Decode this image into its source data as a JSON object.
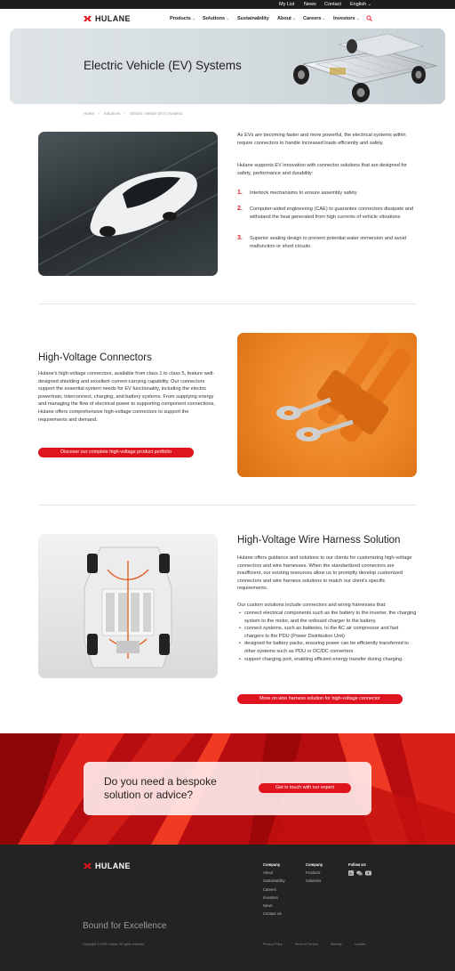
{
  "utility_nav": {
    "my_list": "My List",
    "news": "News",
    "contact": "Contact",
    "language": "English"
  },
  "brand": {
    "name": "HULANE",
    "accent": "#e0141e"
  },
  "main_nav": [
    {
      "label": "Products",
      "dropdown": true
    },
    {
      "label": "Solutions",
      "dropdown": true
    },
    {
      "label": "Sustainability",
      "dropdown": false
    },
    {
      "label": "About",
      "dropdown": true
    },
    {
      "label": "Careers",
      "dropdown": true
    },
    {
      "label": "Investors",
      "dropdown": true
    }
  ],
  "hero": {
    "title": "Electric Vehicle (EV) Systems"
  },
  "breadcrumb": [
    "Home",
    "Solutions",
    "Electric Vehicle (EV) Systems"
  ],
  "intro": {
    "p1": "As EVs are becoming faster and more powerful, the electrical systems within require connectors to handle increased loads efficiently and safely.",
    "p2": "Hulane supports EV innovation with connector solutions that are designed for safety, performance and durability:",
    "items": [
      {
        "num": "1.",
        "text": "Interlock mechanisms to ensure assembly safety"
      },
      {
        "num": "2.",
        "text": "Computer-aided engineering (CAE) to guarantee connectors dissipate and withstand the heat generated from high currents of vehicle vibrations"
      },
      {
        "num": "3.",
        "text": "Superior sealing design to prevent potential water immersion and avoid malfunction or short circuits"
      }
    ]
  },
  "hv_connectors": {
    "title": "High-Voltage Connectors",
    "body": "Hulane's high-voltage connectors, available from class 1 to class 5, feature well-designed shielding and excellent current-carrying capability. Our connectors support the essential system needs for EV functionality, including the electric powertrain, interconnect, charging, and battery systems. From supplying energy and managing the flow of electrical power to supporting component connections, Hulane offers comprehensive high-voltage connectors to support the requirements and demand.",
    "button": "Discover our complete high-voltage product portfolio"
  },
  "wire_harness": {
    "title": "High-Voltage Wire Harness Solution",
    "body": "Hulane offers guidance and solutions to our clients for customizing high-voltage connectors and wire harnesses. When the standardized connectors are insufficient, our existing resources allow us to promptly develop customized connectors and wire harness solutions to match our client's specific requirements.",
    "list_intro": "Our custom solutions include connectors and wiring harnesses that:",
    "bullets": [
      "connect electrical components such as the battery to the inverter, the charging system to the motor, and the onboard charger to the battery.",
      "connect systems, such as batteries, to the AC air compressor and fast chargers to the PDU (Power Distribution Unit)",
      "designed for battery packs, ensuring power can be efficiently transferred to other systems such as PDU or DC/DC converters",
      "support charging port, enabling efficient energy transfer during charging."
    ],
    "button": "More on wire harness solution for high-voltage connector"
  },
  "cta": {
    "title": "Do you need a bespoke solution or advice?",
    "button": "Get in touch with our expert"
  },
  "footer": {
    "tagline": "Bound for Excellence",
    "company_col": {
      "title": "Company",
      "links": [
        "About",
        "Sustainability",
        "Careers",
        "Investors",
        "News",
        "Contact Us"
      ]
    },
    "company2_col": {
      "title": "Company",
      "links": [
        "Products",
        "Solutions"
      ]
    },
    "follow": {
      "title": "Follow Us",
      "icons": [
        "linkedin-icon",
        "wechat-icon",
        "youtube-icon"
      ]
    },
    "copyright": "Copyright © 2024 Hulane. All rights reserved.",
    "legal": [
      "Privacy Policy",
      "Terms of Service",
      "Sitemap",
      "Cookies"
    ]
  }
}
